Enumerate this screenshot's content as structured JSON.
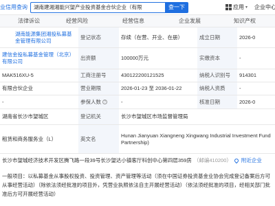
{
  "header": {
    "logo_fragment": "企业信用查询",
    "search_value": "湖南建湘湘能兴望产业投资基金合伙企业（有限",
    "search_button": "查一下",
    "app_label": "应用",
    "app_caret": "▾",
    "corp_label": "企业中心"
  },
  "nav": [
    "法律诉讼",
    "经营风险",
    "经营信息",
    "企业发展",
    "知识产权"
  ],
  "rows": {
    "r1": {
      "c1": "湖南能源集团湘投私募基金管理有限公司",
      "l2": "登记状态",
      "v2": "存续（在营、开业、在册）",
      "l3": "成立日期",
      "v3": "2026-0"
    },
    "r2": {
      "c1": "建信金投私募基金管理（北京）有限公司",
      "l2": "出资额",
      "v2": "100000万元",
      "l3": "实缴资本",
      "v3": "-"
    },
    "r3": {
      "c1": "MAK516XU-5",
      "l2": "工商注册号",
      "v2": "430122200121525",
      "l3": "纳税人识别号",
      "v3": "914301"
    },
    "r4": {
      "c1": "有限合伙企业",
      "l2": "营业期限",
      "v2": "2026-01-23 至 2036-01-22",
      "l3": "纳税人资质",
      "v3": "-"
    },
    "r5": {
      "c1": "-",
      "l2": "参保人数",
      "v2": "-",
      "l3": "核准日期",
      "v3": "2026-0"
    },
    "r6": {
      "c1": "湖南省长沙市望城区",
      "l2": "登记机关",
      "v2": "长沙市望城区市场监督管理局"
    },
    "r7": {
      "c1": "租赁和商务服务业（L）",
      "l2": "英文名",
      "v2": "Hunan Jianyuan Xiangneng Xingwang Industrial Investment Fund Partnership)"
    }
  },
  "address": {
    "text": "长沙市望城经济技术开发区腾飞路一段39号长沙望达小镇客厅科创中心第四层359房",
    "postcode": "（邮编410200）",
    "near": "附近企业"
  },
  "scope": "一般项目：以私募基金从事股权投资、投资管理、资产管理等活动（须在中国证券投资基金业协会完成登记备案后方可从事经营活动）（除依法须经批准的项目外，凭营业执照依法自主开展经营活动）（依法须经批准的项目，经相关部门批准后方可开展经营活动）"
}
